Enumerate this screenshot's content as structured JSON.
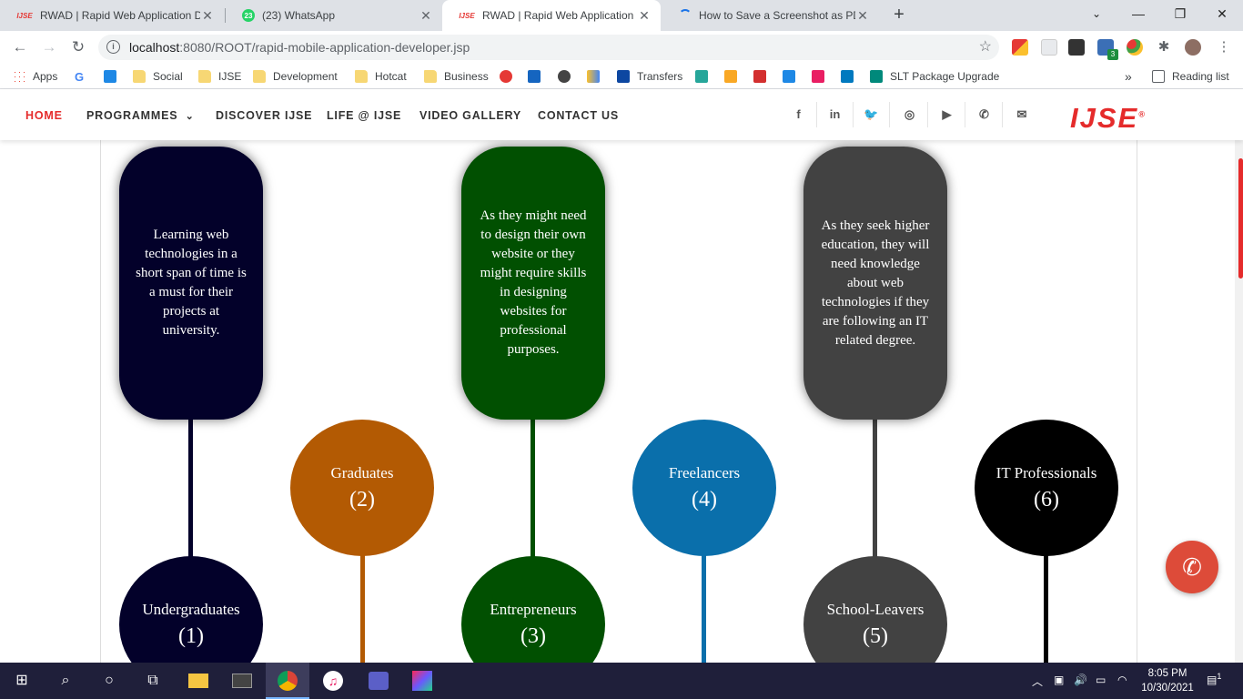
{
  "browser": {
    "tabs": [
      {
        "favicon": "IJSE",
        "title": "RWAD | Rapid Web Application D",
        "active": false
      },
      {
        "favicon": "23",
        "title": "(23) WhatsApp",
        "active": false
      },
      {
        "favicon": "IJSE",
        "title": "RWAD | Rapid Web Application D",
        "active": true
      },
      {
        "favicon": "",
        "title": "How to Save a Screenshot as PDF",
        "active": false
      }
    ],
    "new_tab": "+",
    "window_controls": {
      "minimize": "⌄",
      "min": "—",
      "restore": "❐",
      "close": "✕"
    },
    "address": {
      "host": "localhost",
      "path": ":8080/ROOT/rapid-mobile-application-developer.jsp"
    },
    "extension_badge": "3",
    "bookmarks": [
      "Apps",
      "Social",
      "IJSE",
      "Development",
      "Hotcat",
      "Business",
      "Transfers",
      "SLT Package Upgrade"
    ],
    "bookmarks_more": "»",
    "reading_list": "Reading list"
  },
  "site_nav": {
    "items": [
      {
        "label": "HOME",
        "active": true
      },
      {
        "label": "PROGRAMMES",
        "active": false
      },
      {
        "label": "DISCOVER IJSE",
        "active": false
      },
      {
        "label": "LIFE @ IJSE",
        "active": false
      },
      {
        "label": "VIDEO GALLERY",
        "active": false
      },
      {
        "label": "CONTACT US",
        "active": false
      }
    ],
    "programmes_chevron": "⌄",
    "social": [
      "facebook-icon",
      "linkedin-icon",
      "twitter-icon",
      "instagram-icon",
      "youtube-icon",
      "phone-icon",
      "mail-icon"
    ],
    "logo": "IJSE",
    "logo_mark": "®"
  },
  "audience": [
    {
      "name": "Undergraduates",
      "number": "(1)",
      "color": "#03012a",
      "description": "Learning web technologies in a short span of time is a must for their projects at university."
    },
    {
      "name": "Graduates",
      "number": "(2)",
      "color": "#b35a03",
      "description": ""
    },
    {
      "name": "Entrepreneurs",
      "number": "(3)",
      "color": "#015001",
      "description": "As they might need to design their own website or they might require skills in designing websites for professional purposes."
    },
    {
      "name": "Freelancers",
      "number": "(4)",
      "color": "#0a6fab",
      "description": ""
    },
    {
      "name": "School-Leavers",
      "number": "(5)",
      "color": "#424242",
      "description": "As they seek higher education, they will need knowledge about web technologies if they are following an IT related degree."
    },
    {
      "name": "IT Professionals",
      "number": "(6)",
      "color": "#000000",
      "description": ""
    }
  ],
  "taskbar": {
    "time": "8:05 PM",
    "date": "10/30/2021",
    "notifications": "1"
  }
}
